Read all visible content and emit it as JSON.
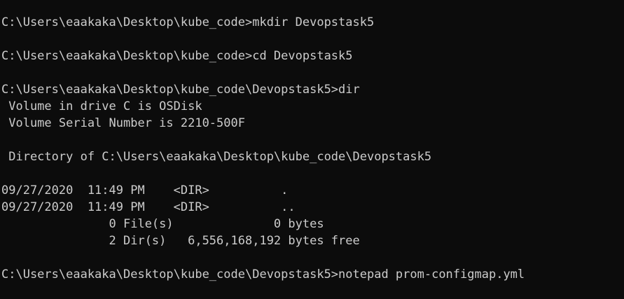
{
  "terminal": {
    "background_color": "#0c0c0c",
    "text_color": "#cccccc",
    "lines": [
      "C:\\Users\\eaakaka\\Desktop\\kube_code>mkdir Devopstask5",
      "",
      "C:\\Users\\eaakaka\\Desktop\\kube_code>cd Devopstask5",
      "",
      "C:\\Users\\eaakaka\\Desktop\\kube_code\\Devopstask5>dir",
      " Volume in drive C is OSDisk",
      " Volume Serial Number is 2210-500F",
      "",
      " Directory of C:\\Users\\eaakaka\\Desktop\\kube_code\\Devopstask5",
      "",
      "09/27/2020  11:49 PM    <DIR>          .",
      "09/27/2020  11:49 PM    <DIR>          ..",
      "               0 File(s)              0 bytes",
      "               2 Dir(s)   6,556,168,192 bytes free",
      "",
      "C:\\Users\\eaakaka\\Desktop\\kube_code\\Devopstask5>notepad prom-configmap.yml"
    ]
  }
}
